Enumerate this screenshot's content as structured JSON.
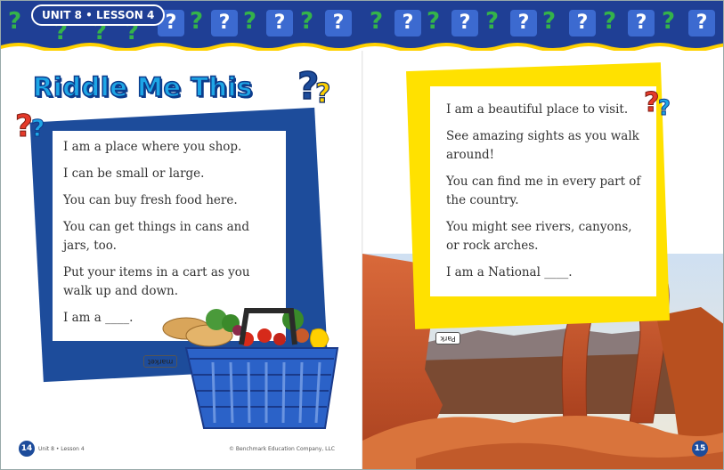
{
  "header": {
    "unit_lesson": "UNIT 8 • LESSON 4"
  },
  "left_page": {
    "title": "Riddle Me This",
    "riddle_lines": [
      "I am a place where you shop.",
      "I can be small or large.",
      "You can buy fresh food here.",
      "You can get things in cans and jars, too.",
      "Put your items in a cart as you walk up and down.",
      "I am a ____."
    ],
    "answer": "market",
    "page_number": "14",
    "footer_left": "Unit 8 • Lesson 4",
    "footer_center": "© Benchmark Education Company, LLC"
  },
  "right_page": {
    "riddle_lines": [
      "I am a beautiful place to visit.",
      "See amazing sights as you walk around!",
      "You can find me in every part of the country.",
      "You might see rivers, canyons, or rock arches.",
      "I am a National ____."
    ],
    "answer": "Park",
    "page_number": "15"
  },
  "colors": {
    "banner": "#1f3f95",
    "title": "#1ea6e6",
    "card_left": "#1d4c9b",
    "card_right": "#ffe100"
  },
  "icons": [
    "question-mark-icon",
    "basket-image",
    "arch-photo"
  ]
}
